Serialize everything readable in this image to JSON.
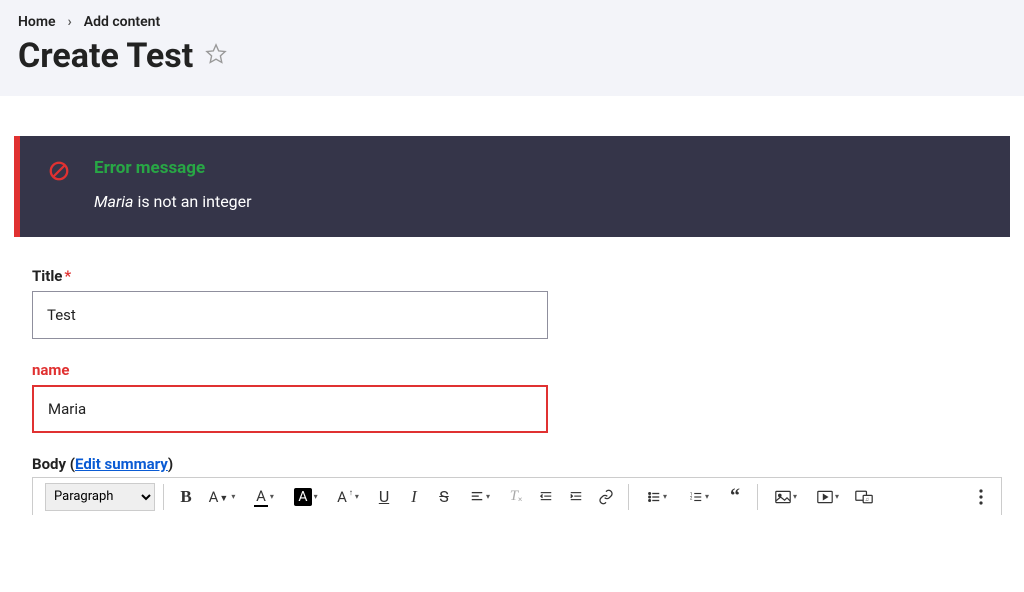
{
  "breadcrumb": {
    "home": "Home",
    "add_content": "Add content"
  },
  "page_title": "Create Test",
  "error": {
    "heading": "Error message",
    "text_prefix_italic": "Maria",
    "text_rest": "is not an integer"
  },
  "form": {
    "title": {
      "label": "Title",
      "value": "Test"
    },
    "name": {
      "label": "name",
      "value": "Maria"
    },
    "body": {
      "label_prefix": "Body (",
      "edit_summary": "Edit summary",
      "label_suffix": ")"
    }
  },
  "toolbar": {
    "style_select": "Paragraph"
  }
}
